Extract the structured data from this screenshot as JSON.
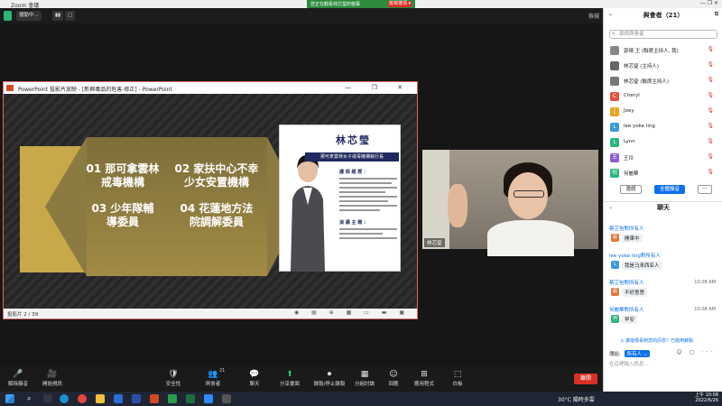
{
  "window": {
    "title": "Zoom 會議",
    "share_banner": "您正在觀看林芯瑩的螢幕",
    "view_options": "檢視選項 ▾",
    "view_label": "檢視",
    "controls": "— ❐ ✕"
  },
  "top_chips": {
    "chip1": "播動中...",
    "chip2": "▮▮",
    "chip3": "▢"
  },
  "ppt": {
    "title": "PowerPoint 投影片放映 - [新興毒品的危害-修正] - PowerPoint",
    "controls": "— ❐ ✕",
    "slide_count": "投影片 2 / 39",
    "status_icons": "◉ ▤ ⊕ ▦ ▭ ▬ ▣",
    "items": [
      "01 那可拿雲林\n戒毒機構",
      "02 家扶中心不幸\n少女安置機構",
      "03 少年隊輔\n導委員",
      "04 花蓮地方法\n院調解委員"
    ],
    "card_name": "林芯瑩",
    "card_role": "那可拿雲林女子戒毒機構執行長",
    "card_sec1": "護 師 經 歷 ：",
    "card_sec2": "演 講 主 題 ："
  },
  "video": {
    "name": "林芯瑩"
  },
  "toolbar": {
    "items": [
      {
        "icon": "🎤",
        "label": "解除靜音"
      },
      {
        "icon": "🎥",
        "label": "開始視訊"
      },
      {
        "icon": "🛡",
        "label": "安全性"
      },
      {
        "icon": "👥",
        "label": "與會者",
        "badge": "21"
      },
      {
        "icon": "💬",
        "label": "聊天"
      },
      {
        "icon": "⬆",
        "label": "分享畫面"
      },
      {
        "icon": "⏺",
        "label": "錄製/停止錄製"
      },
      {
        "icon": "▦",
        "label": "分組討論"
      },
      {
        "icon": "☺",
        "label": "回應"
      },
      {
        "icon": "⊞",
        "label": "應用程式"
      },
      {
        "icon": "⬚",
        "label": "白板"
      }
    ],
    "end": "離開"
  },
  "taskbar": {
    "weather": "30°C 陽時多雲",
    "time": "上午 10:08",
    "date": "2022/6/26"
  },
  "panel": {
    "title": "與會者（21）",
    "search_placeholder": "尋找與會者",
    "participants": [
      {
        "name": "郭晴 王 (聯席主持人, 我)",
        "avatar": "",
        "color": "#888"
      },
      {
        "name": "林芯瑩 (主持人)",
        "avatar": "",
        "color": "#666"
      },
      {
        "name": "林芯瑩 (聯席主持人)",
        "avatar": "",
        "color": "#777"
      },
      {
        "name": "Cheryl",
        "avatar": "C",
        "color": "#e0533d"
      },
      {
        "name": "Joey",
        "avatar": "J",
        "color": "#f0a020"
      },
      {
        "name": "lee yoke ling",
        "avatar": "L",
        "color": "#3a9ad9"
      },
      {
        "name": "Lynn",
        "avatar": "L",
        "color": "#2cb57a"
      },
      {
        "name": "王玲",
        "avatar": "王",
        "color": "#8d5bd1"
      },
      {
        "name": "何麗華",
        "avatar": "何",
        "color": "#2cb57a"
      }
    ],
    "invite": "邀請",
    "mute_all": "全體靜音",
    "more": "···",
    "chat_title": "聊天",
    "messages": [
      {
        "from": "蔡芷怡對所有人",
        "text": "開車中",
        "avatar": "蔡",
        "color": "#e07a3d",
        "time": ""
      },
      {
        "from": "lee yoke ling對所有人",
        "text": "我是马来西亚人",
        "avatar": "L",
        "color": "#3a9ad9",
        "time": ""
      },
      {
        "from": "蔡芷怡對所有人",
        "text": "不好意思",
        "avatar": "蔡",
        "color": "#e07a3d",
        "time": "10:08 AM"
      },
      {
        "from": "何麗華對所有人",
        "text": "早安",
        "avatar": "何",
        "color": "#2cb57a",
        "time": "10:08 AM"
      }
    ],
    "file_note": "⚠ 誰能檢看到您的訊息？已啟用錄製",
    "send_to_label": "傳給:",
    "send_to_value": "所有人 ⌄",
    "input_placeholder": "在這裡輸入訊息..."
  }
}
